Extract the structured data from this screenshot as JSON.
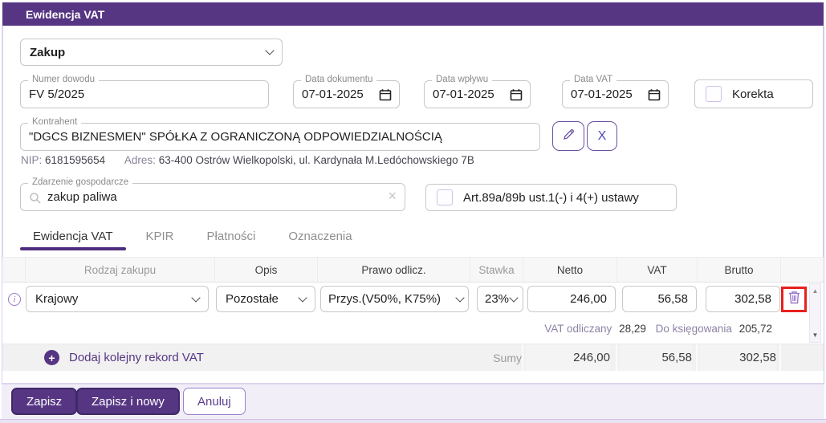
{
  "title": "Ewidencja VAT",
  "colors": {
    "accent": "#563683",
    "highlight_red": "#e8201d"
  },
  "form": {
    "type_select": {
      "value": "Zakup"
    },
    "numer_dowodu": {
      "label": "Numer dowodu",
      "value": "FV 5/2025"
    },
    "data_dokumentu": {
      "label": "Data dokumentu",
      "value": "07-01-2025"
    },
    "data_wplywu": {
      "label": "Data wpływu",
      "value": "07-01-2025"
    },
    "data_vat": {
      "label": "Data VAT",
      "value": "07-01-2025"
    },
    "korekta": {
      "label": "Korekta",
      "checked": false
    },
    "kontrahent": {
      "label": "Kontrahent",
      "value": "\"DGCS BIZNESMEN\" SPÓŁKA Z OGRANICZONĄ ODPOWIEDZIALNOŚCIĄ",
      "clear_glyph": "X"
    },
    "kontrahent_info": {
      "nip_label": "NIP:",
      "nip_value": "6181595654",
      "adres_label": "Adres:",
      "adres_value": "63-400 Ostrów Wielkopolski, ul. Kardynała M.Ledóchowskiego 7B"
    },
    "zdarzenie": {
      "label": "Zdarzenie gospodarcze",
      "value": "zakup paliwa",
      "clear_glyph": "×"
    },
    "art_checkbox": {
      "label": "Art.89a/89b ust.1(-) i 4(+) ustawy",
      "checked": false
    }
  },
  "tabs": [
    {
      "label": "Ewidencja VAT",
      "active": true
    },
    {
      "label": "KPIR",
      "active": false
    },
    {
      "label": "Płatności",
      "active": false
    },
    {
      "label": "Oznaczenia",
      "active": false
    }
  ],
  "table": {
    "headers": [
      "Rodzaj zakupu",
      "Opis",
      "Prawo odlicz.",
      "Stawka",
      "Netto",
      "VAT",
      "Brutto"
    ],
    "row": {
      "rodzaj_zakupu": "Krajowy",
      "opis": "Pozostałe",
      "prawo_odlicz": "Przys.(V50%, K75%)",
      "stawka": "23%",
      "netto": "246,00",
      "vat": "56,58",
      "brutto": "302,58"
    },
    "row_summary": {
      "vat_odliczany_label": "VAT odliczany",
      "vat_odliczany_value": "28,29",
      "do_ksiegowania_label": "Do księgowania",
      "do_ksiegowania_value": "205,72"
    },
    "add_row_label": "Dodaj kolejny rekord VAT",
    "sums": {
      "label": "Sumy",
      "netto": "246,00",
      "vat": "56,58",
      "brutto": "302,58"
    },
    "scrollbar": {
      "up_glyph": "▲",
      "down_glyph": "▼"
    }
  },
  "footer": {
    "zapisz": "Zapisz",
    "zapisz_i_nowy": "Zapisz i nowy",
    "anuluj": "Anuluj"
  }
}
